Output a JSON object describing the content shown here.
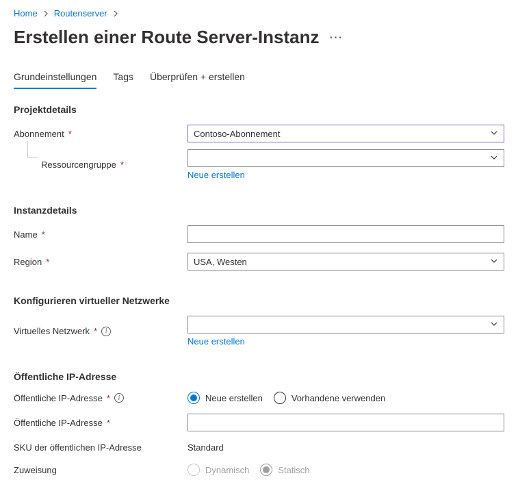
{
  "breadcrumb": {
    "home": "Home",
    "parent": "Routenserver"
  },
  "page_title": "Erstellen einer Route Server-Instanz",
  "tabs": {
    "basics": "Grundeinstellungen",
    "tags": "Tags",
    "review": "Überprüfen + erstellen"
  },
  "sections": {
    "project": "Projektdetails",
    "instance": "Instanzdetails",
    "vnet": "Konfigurieren virtueller Netzwerke",
    "publicip": "Öffentliche IP-Adresse"
  },
  "labels": {
    "subscription": "Abonnement",
    "resource_group": "Ressourcengruppe",
    "name": "Name",
    "region": "Region",
    "vnet": "Virtuelles Netzwerk",
    "public_ip_mode": "Öffentliche IP-Adresse",
    "public_ip_name": "Öffentliche IP-Adresse",
    "sku": "SKU der öffentlichen IP-Adresse",
    "assignment": "Zuweisung"
  },
  "values": {
    "subscription": "Contoso-Abonnement",
    "resource_group": "",
    "name": "",
    "region": "USA, Westen",
    "vnet": "",
    "sku": "Standard"
  },
  "links": {
    "create_new": "Neue erstellen"
  },
  "radios": {
    "ip_new": "Neue erstellen",
    "ip_existing": "Vorhandene verwenden",
    "dynamic": "Dynamisch",
    "static": "Statisch"
  }
}
